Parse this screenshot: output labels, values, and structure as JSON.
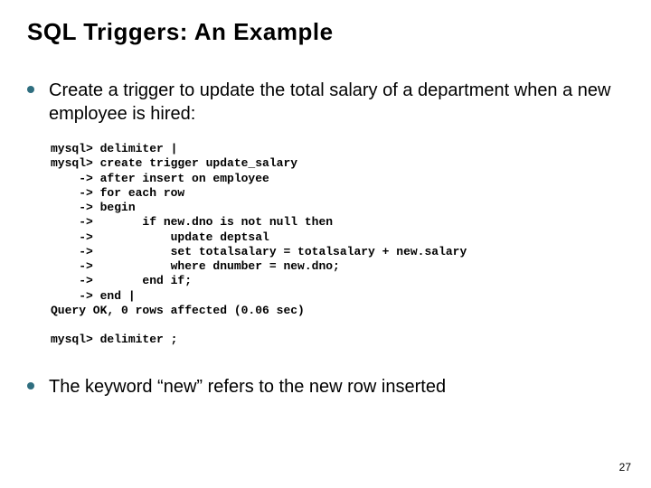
{
  "title": "SQL Triggers: An Example",
  "bullets": [
    "Create a trigger to update the total salary of a department when a new employee is hired:",
    "The keyword “new” refers to the new row inserted"
  ],
  "code": "mysql> delimiter |\nmysql> create trigger update_salary\n    -> after insert on employee\n    -> for each row\n    -> begin\n    ->       if new.dno is not null then\n    ->           update deptsal\n    ->           set totalsalary = totalsalary + new.salary\n    ->           where dnumber = new.dno;\n    ->       end if;\n    -> end |\nQuery OK, 0 rows affected (0.06 sec)\n\nmysql> delimiter ;",
  "page_number": "27"
}
